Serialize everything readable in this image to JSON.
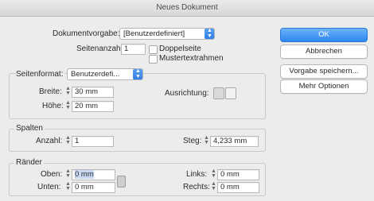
{
  "window": {
    "title": "Neues Dokument"
  },
  "preset": {
    "label": "Dokumentvorgabe:",
    "value": "[Benutzerdefiniert]"
  },
  "pages": {
    "count_label": "Seitenanzahl:",
    "count_value": "1"
  },
  "options": {
    "facing_pages": "Doppelseite",
    "master_text_frame": "Mustertextrahmen"
  },
  "page_size": {
    "label": "Seitenformat:",
    "value": "Benutzerdefi...",
    "width_label": "Breite:",
    "width_value": "30 mm",
    "height_label": "Höhe:",
    "height_value": "20 mm",
    "orientation_label": "Ausrichtung:"
  },
  "columns": {
    "group_title": "Spalten",
    "count_label": "Anzahl:",
    "count_value": "1",
    "gutter_label": "Steg:",
    "gutter_value": "4,233 mm"
  },
  "margins": {
    "group_title": "Ränder",
    "top_label": "Oben:",
    "top_value": "0 mm",
    "bottom_label": "Unten:",
    "bottom_value": "0 mm",
    "left_label": "Links:",
    "left_value": "0 mm",
    "right_label": "Rechts:",
    "right_value": "0 mm"
  },
  "buttons": {
    "ok": "OK",
    "cancel": "Abbrechen",
    "save_preset": "Vorgabe speichern...",
    "more_options": "Mehr Optionen"
  },
  "colors": {
    "accent": "#2d86f0"
  },
  "icons": {
    "stepper": "stepper-arrows-icon",
    "select": "dropdown-arrows-icon",
    "portrait": "portrait-orientation-icon",
    "landscape": "landscape-orientation-icon",
    "link": "chain-link-icon"
  }
}
